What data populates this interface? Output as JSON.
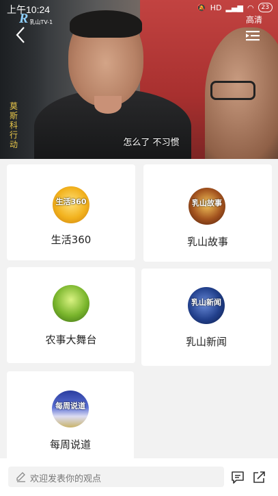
{
  "status_bar": {
    "time": "上午10:24",
    "network": "HD",
    "battery": "23"
  },
  "player": {
    "channel_logo_letter": "R",
    "channel_name": "乳山TV-1",
    "quality_label": "高清",
    "vertical_title": [
      "莫",
      "斯",
      "科",
      "行",
      "动"
    ],
    "subtitle": "怎么了 不习惯"
  },
  "programs": [
    {
      "title": "生活360",
      "thumb_text": "生活360"
    },
    {
      "title": "乳山故事",
      "thumb_text": "乳山故事"
    },
    {
      "title": "农事大舞台",
      "thumb_text": ""
    },
    {
      "title": "乳山新闻",
      "thumb_text": "乳山新闻"
    },
    {
      "title": "每周说道",
      "thumb_text": "每周说道"
    }
  ],
  "bottom_bar": {
    "comment_placeholder": "欢迎发表你的观点"
  },
  "colors": {
    "background": "#f2f2f2",
    "card": "#ffffff",
    "title_accent": "#e8c64a"
  }
}
